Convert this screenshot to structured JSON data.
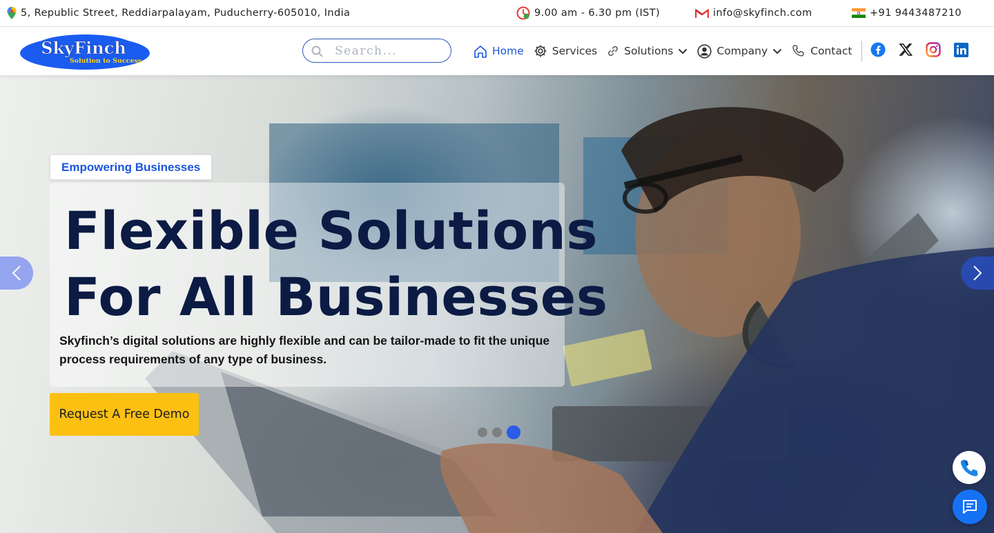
{
  "topbar": {
    "address": "5, Republic Street, Reddiarpalayam, Puducherry-605010, India",
    "hours": "9.00 am - 6.30 pm (IST)",
    "email": "info@skyfinch.com",
    "phone": "+91 9443487210",
    "icons": [
      "map-pin-icon",
      "clock-icon",
      "gmail-icon",
      "india-flag-icon"
    ]
  },
  "logo": {
    "name": "SkyFinch",
    "tagline": "Solution to Success"
  },
  "search": {
    "placeholder": "Search..."
  },
  "nav": {
    "items": [
      {
        "label": "Home",
        "icon": "home-icon",
        "active": true
      },
      {
        "label": "Services",
        "icon": "gear-icon"
      },
      {
        "label": "Solutions",
        "icon": "link-icon",
        "dropdown": true
      },
      {
        "label": "Company",
        "icon": "user-circle-icon",
        "dropdown": true
      },
      {
        "label": "Contact",
        "icon": "phone-icon"
      }
    ],
    "socials": [
      "facebook-icon",
      "x-icon",
      "instagram-icon",
      "linkedin-icon"
    ]
  },
  "hero": {
    "tagline": "Empowering Businesses",
    "headline_line1": "Flexible Solutions",
    "headline_line2": "For All Businesses",
    "description": "Skyfinch’s digital solutions are highly flexible and can be tailor-made to fit the unique process requirements of any type of business.",
    "cta": "Request A Free Demo",
    "slides_total": 3,
    "active_slide": 3
  },
  "colors": {
    "accent": "#1a56db",
    "cta": "#fcc012",
    "headline": "#0b1b44"
  }
}
